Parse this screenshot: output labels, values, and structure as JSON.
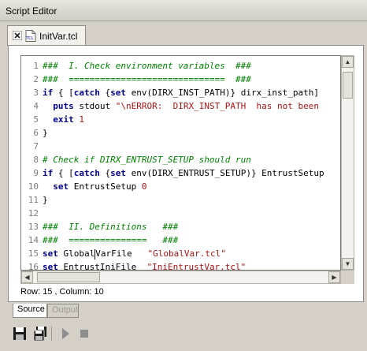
{
  "window": {
    "title": "Script Editor"
  },
  "tab": {
    "label": "InitVar.tcl",
    "icon_text": "TCL"
  },
  "editor": {
    "lines": [
      {
        "num": "1",
        "parts": [
          {
            "c": "c",
            "t": "###  I. Check environment variables  ###"
          }
        ]
      },
      {
        "num": "2",
        "parts": [
          {
            "c": "c",
            "t": "###  ==============================  ###"
          }
        ]
      },
      {
        "num": "3",
        "parts": [
          {
            "c": "k",
            "t": "if"
          },
          {
            "c": "t",
            "t": " { ["
          },
          {
            "c": "k",
            "t": "catch"
          },
          {
            "c": "t",
            "t": " {"
          },
          {
            "c": "k",
            "t": "set"
          },
          {
            "c": "t",
            "t": " env(DIRX_INST_PATH)} dirx_inst_path]"
          }
        ]
      },
      {
        "num": "4",
        "parts": [
          {
            "c": "t",
            "t": "  "
          },
          {
            "c": "k",
            "t": "puts"
          },
          {
            "c": "t",
            "t": " stdout "
          },
          {
            "c": "s",
            "t": "\"\\nERROR:  DIRX_INST_PATH  has not been"
          }
        ]
      },
      {
        "num": "5",
        "parts": [
          {
            "c": "t",
            "t": "  "
          },
          {
            "c": "k",
            "t": "exit"
          },
          {
            "c": "t",
            "t": " "
          },
          {
            "c": "n",
            "t": "1"
          }
        ]
      },
      {
        "num": "6",
        "parts": [
          {
            "c": "t",
            "t": "}"
          }
        ]
      },
      {
        "num": "7",
        "parts": []
      },
      {
        "num": "8",
        "parts": [
          {
            "c": "c",
            "t": "# Check if DIRX_ENTRUST_SETUP should run"
          }
        ]
      },
      {
        "num": "9",
        "parts": [
          {
            "c": "k",
            "t": "if"
          },
          {
            "c": "t",
            "t": " { ["
          },
          {
            "c": "k",
            "t": "catch"
          },
          {
            "c": "t",
            "t": " {"
          },
          {
            "c": "k",
            "t": "set"
          },
          {
            "c": "t",
            "t": " env(DIRX_ENTRUST_SETUP)} EntrustSetup"
          }
        ]
      },
      {
        "num": "10",
        "parts": [
          {
            "c": "t",
            "t": "  "
          },
          {
            "c": "k",
            "t": "set"
          },
          {
            "c": "t",
            "t": " EntrustSetup "
          },
          {
            "c": "n",
            "t": "0"
          }
        ]
      },
      {
        "num": "11",
        "parts": [
          {
            "c": "t",
            "t": "}"
          }
        ]
      },
      {
        "num": "12",
        "parts": []
      },
      {
        "num": "13",
        "parts": [
          {
            "c": "c",
            "t": "###  II. Definitions   ###"
          }
        ]
      },
      {
        "num": "14",
        "parts": [
          {
            "c": "c",
            "t": "###  ===============   ###"
          }
        ]
      },
      {
        "num": "15",
        "parts": [
          {
            "c": "k",
            "t": "set"
          },
          {
            "c": "t",
            "t": " Global"
          },
          {
            "c": "caret",
            "t": ""
          },
          {
            "c": "t",
            "t": "VarFile   "
          },
          {
            "c": "s",
            "t": "\"GlobalVar.tcl\""
          }
        ]
      },
      {
        "num": "16",
        "parts": [
          {
            "c": "k",
            "t": "set"
          },
          {
            "c": "t",
            "t": " EntrustIniFile  "
          },
          {
            "c": "s",
            "t": "\"IniEntrustVar.tcl\""
          }
        ]
      }
    ]
  },
  "status": {
    "text": "Row: 15 , Column: 10"
  },
  "subtabs": {
    "source": "Source",
    "output": "Output"
  },
  "toolbar": {
    "icons": [
      "save-icon",
      "save-all-icon",
      "run-icon",
      "stop-icon"
    ]
  },
  "colors": {
    "comment": "#008000",
    "keyword": "#00008b",
    "string": "#a31515",
    "background": "#d4d0c8"
  }
}
